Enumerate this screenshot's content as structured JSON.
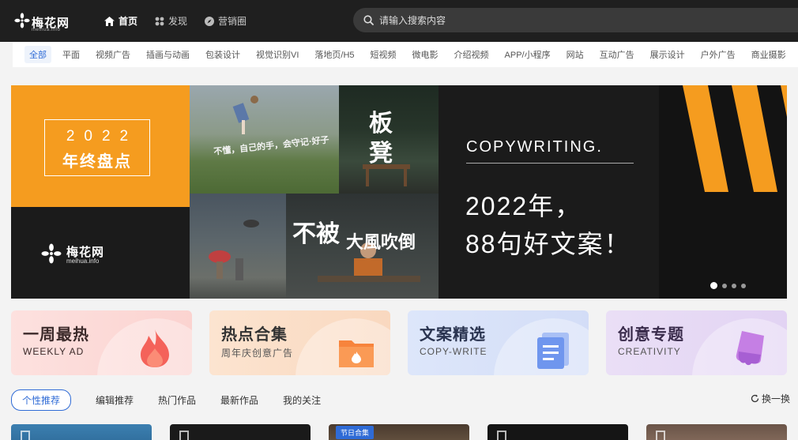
{
  "logo": {
    "name": "梅花网",
    "sub": "meihua.info"
  },
  "nav": [
    {
      "label": "首页",
      "icon": "home-icon",
      "active": true
    },
    {
      "label": "发现",
      "icon": "grid-icon",
      "active": false
    },
    {
      "label": "营销圈",
      "icon": "compass-icon",
      "active": false
    }
  ],
  "search": {
    "placeholder": "请输入搜索内容"
  },
  "categories": [
    "全部",
    "平面",
    "视频广告",
    "插画与动画",
    "包装设计",
    "视觉识别VI",
    "落地页/H5",
    "短视频",
    "微电影",
    "介绍视频",
    "APP/小程序",
    "网站",
    "互动广告",
    "展示设计",
    "户外广告",
    "商业摄影"
  ],
  "banner": {
    "year": "2022",
    "year_title": "年终盘点",
    "logo_name": "梅花网",
    "logo_sub": "meihua.info",
    "cap1": "不懂，自己的手，会守记·好子",
    "cap2": "板凳",
    "cap3": "不被",
    "cap4": "大風吹倒",
    "copy_en": "COPYWRITING.",
    "copy_zh1": "2022年，",
    "copy_zh2": "88句好文案！",
    "slide_count": 4,
    "active_slide": 1,
    "colors": {
      "orange": "#f59c1f",
      "dark": "#1b1b1b"
    }
  },
  "cards": [
    {
      "title": "一周最热",
      "sub": "WEEKLY AD",
      "icon": "flame-icon"
    },
    {
      "title": "热点合集",
      "sub": "周年庆创意广告",
      "icon": "folder-icon"
    },
    {
      "title": "文案精选",
      "sub": "COPY-WRITE",
      "icon": "document-icon"
    },
    {
      "title": "创意专题",
      "sub": "CREATIVITY",
      "icon": "brush-icon"
    }
  ],
  "tabs": [
    {
      "label": "个性推荐",
      "active": true
    },
    {
      "label": "编辑推荐",
      "active": false
    },
    {
      "label": "热门作品",
      "active": false
    },
    {
      "label": "最新作品",
      "active": false
    },
    {
      "label": "我的关注",
      "active": false
    }
  ],
  "refresh_label": "换一换",
  "thumb_badge": "节日合集",
  "accent": "#2f6bd6"
}
